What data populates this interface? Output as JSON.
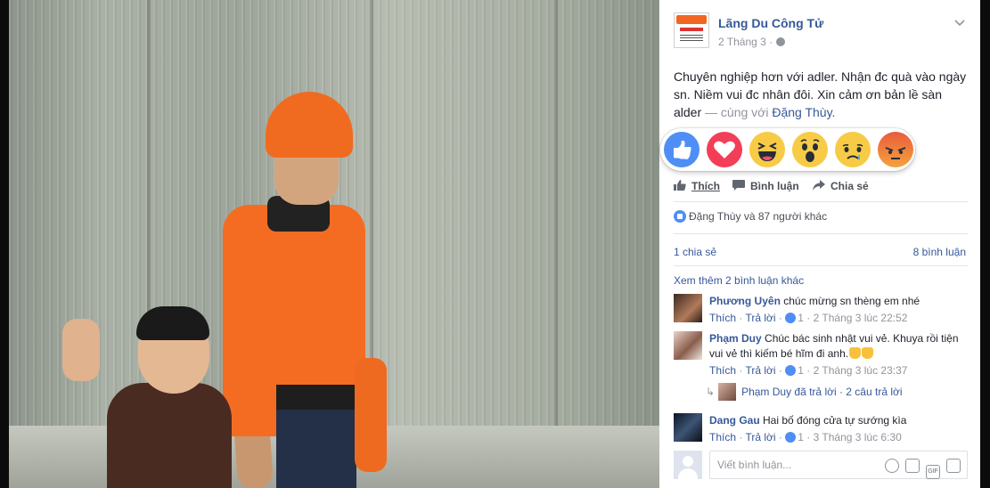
{
  "post": {
    "page_name": "Lãng Du Công Tử",
    "date": "2 Tháng 3 ·",
    "text_main": "Chuyên nghiệp hơn với adler. Nhận đc quà vào ngày sn. Niềm vui đc nhân đôi. Xin cảm ơn bản lề sàn alder",
    "text_with": "— cùng với",
    "tagged": "Đặng Thùy."
  },
  "reactions": [
    "like",
    "love",
    "haha",
    "wow",
    "sad",
    "angry"
  ],
  "actions": {
    "like": "Thích",
    "comment": "Bình luận",
    "share": "Chia sẻ"
  },
  "stats": {
    "likers": "Đặng Thùy và 87 người khác",
    "shares": "1 chia sẻ",
    "comments": "8 bình luận"
  },
  "more_comments": "Xem thêm 2 bình luận khác",
  "comments": [
    {
      "author": "Phương Uyên",
      "text": "chúc mừng sn thèng em nhé",
      "like": "Thích",
      "reply": "Trả lời",
      "likes": "1",
      "time": "2 Tháng 3 lúc 22:52"
    },
    {
      "author": "Phạm Duy",
      "text": "Chúc bác sinh nhật vui vẻ. Khuya rồi tiện vui vẻ thì kiếm bé hĩm đi anh.",
      "like": "Thích",
      "reply": "Trả lời",
      "likes": "1",
      "time": "2 Tháng 3 lúc 23:37"
    },
    {
      "author": "Dang Gau",
      "text": "Hai bố đóng cửa tự sướng kìa",
      "like": "Thích",
      "reply": "Trả lời",
      "likes": "1",
      "time": "3 Tháng 3 lúc 6:30"
    }
  ],
  "reply_summary": {
    "text": "Phạm Duy đã trả lời · 2 câu trả lời"
  },
  "composer": {
    "placeholder": "Viết bình luận..."
  },
  "composer_icons": [
    "smiley-icon",
    "camera-icon",
    "gif-icon",
    "sticker-icon"
  ],
  "gif_label": "GIF",
  "colors": {
    "link": "#365899",
    "like_blue": "#4f8ef5",
    "love_red": "#f33e58",
    "emoji_yellow": "#f7cb45"
  }
}
